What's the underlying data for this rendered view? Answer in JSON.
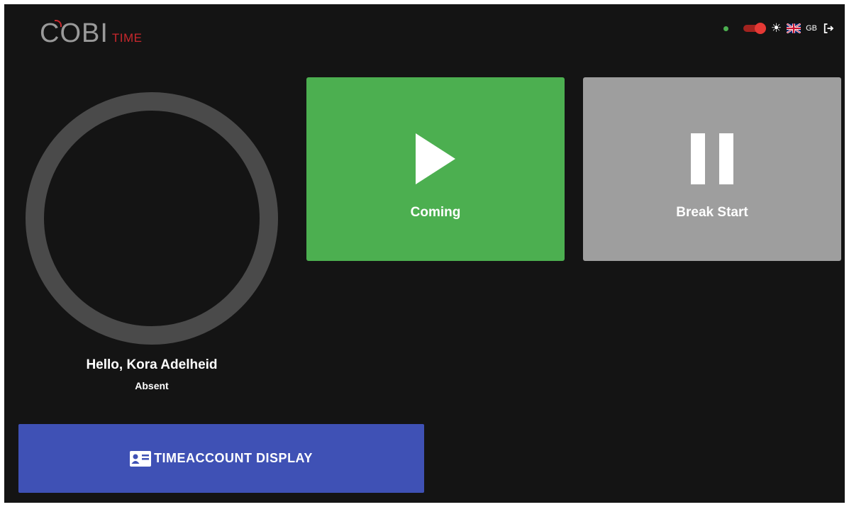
{
  "logo": {
    "main": "COBI",
    "sub": "TIME"
  },
  "toolbar": {
    "online_color": "#4caf50",
    "toggle_state": "on",
    "theme_icon": "sun-icon",
    "flag_icon": "uk-flag-icon",
    "language": "GB",
    "logout_icon": "logout-icon"
  },
  "user": {
    "greeting": "Hello, Kora Adelheid",
    "status": "Absent"
  },
  "actions": {
    "coming": {
      "label": "Coming",
      "icon": "play-icon",
      "color": "#4caf50"
    },
    "break_start": {
      "label": "Break Start",
      "icon": "pause-icon",
      "color": "#9e9e9e"
    }
  },
  "timeaccount": {
    "label": "TIMEACCOUNT DISPLAY",
    "icon": "id-card-icon",
    "color": "#3f51b5"
  },
  "colors": {
    "background": "#141414",
    "accent_red": "#c8282d",
    "ring": "#4a4a4a"
  }
}
